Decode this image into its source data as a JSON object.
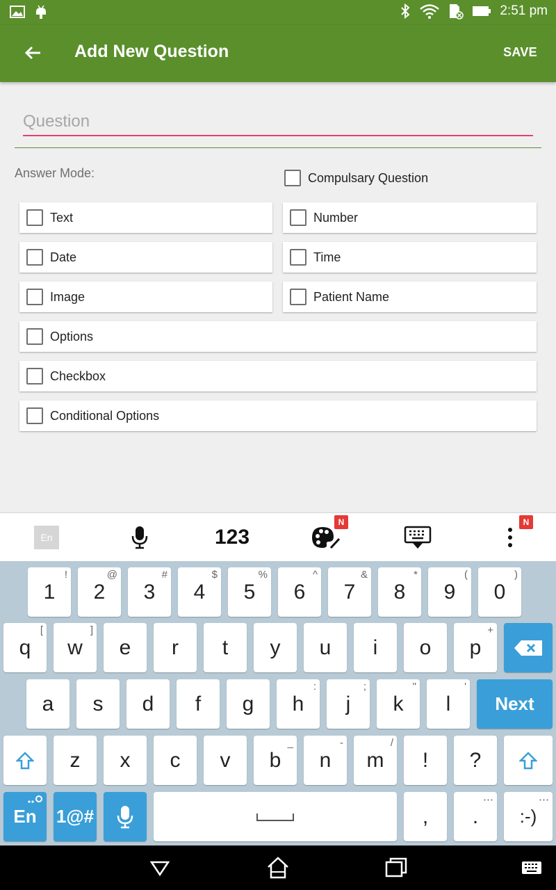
{
  "status_bar": {
    "time": "2:51 pm",
    "icons": [
      "image-icon",
      "android-icon",
      "bluetooth-icon",
      "wifi-icon",
      "sim-icon",
      "battery-icon"
    ]
  },
  "app_bar": {
    "title": "Add New Question",
    "save_label": "SAVE",
    "back_icon": "back-arrow-icon"
  },
  "form": {
    "question_placeholder": "Question",
    "question_value": "",
    "answer_mode_label": "Answer Mode:",
    "compulsory_label": "Compulsary Question",
    "compulsory_checked": false,
    "options": [
      {
        "label": "Text",
        "checked": false
      },
      {
        "label": "Number",
        "checked": false
      },
      {
        "label": "Date",
        "checked": false
      },
      {
        "label": "Time",
        "checked": false
      },
      {
        "label": "Image",
        "checked": false
      },
      {
        "label": "Patient Name",
        "checked": false
      },
      {
        "label": "Options",
        "checked": false
      },
      {
        "label": "Checkbox",
        "checked": false
      },
      {
        "label": "Conditional Options",
        "checked": false
      }
    ]
  },
  "keyboard": {
    "toolbar": {
      "language": "En",
      "numbers_label": "123",
      "badge": "N"
    },
    "number_row": [
      {
        "k": "1",
        "h": "!"
      },
      {
        "k": "2",
        "h": "@"
      },
      {
        "k": "3",
        "h": "#"
      },
      {
        "k": "4",
        "h": "$"
      },
      {
        "k": "5",
        "h": "%"
      },
      {
        "k": "6",
        "h": "^"
      },
      {
        "k": "7",
        "h": "&"
      },
      {
        "k": "8",
        "h": "*"
      },
      {
        "k": "9",
        "h": "("
      },
      {
        "k": "0",
        "h": ")"
      }
    ],
    "row_q": [
      {
        "k": "q",
        "h": "["
      },
      {
        "k": "w",
        "h": "]"
      },
      {
        "k": "e",
        "h": ""
      },
      {
        "k": "r",
        "h": ""
      },
      {
        "k": "t",
        "h": ""
      },
      {
        "k": "y",
        "h": ""
      },
      {
        "k": "u",
        "h": ""
      },
      {
        "k": "i",
        "h": ""
      },
      {
        "k": "o",
        "h": ""
      },
      {
        "k": "p",
        "h": "+"
      }
    ],
    "row_a": [
      {
        "k": "a",
        "h": ""
      },
      {
        "k": "s",
        "h": ""
      },
      {
        "k": "d",
        "h": ""
      },
      {
        "k": "f",
        "h": ""
      },
      {
        "k": "g",
        "h": ""
      },
      {
        "k": "h",
        "h": ":"
      },
      {
        "k": "j",
        "h": ";"
      },
      {
        "k": "k",
        "h": "\""
      },
      {
        "k": "l",
        "h": "'"
      }
    ],
    "next_label": "Next",
    "row_z": [
      {
        "k": "z",
        "h": ""
      },
      {
        "k": "x",
        "h": ""
      },
      {
        "k": "c",
        "h": ""
      },
      {
        "k": "v",
        "h": ""
      },
      {
        "k": "b",
        "h": "_"
      },
      {
        "k": "n",
        "h": "-"
      },
      {
        "k": "m",
        "h": "/"
      },
      {
        "k": "!",
        "h": ""
      },
      {
        "k": "?",
        "h": ""
      }
    ],
    "bottom": {
      "lang": "En",
      "symbols": "1@#",
      "comma": ",",
      "period": ".",
      "smiley": ":-)"
    }
  },
  "colors": {
    "primary": "#5a8f2c",
    "accent": "#e0426f",
    "key_blue": "#3a9fd8",
    "keyboard_bg": "#b7cad6"
  }
}
